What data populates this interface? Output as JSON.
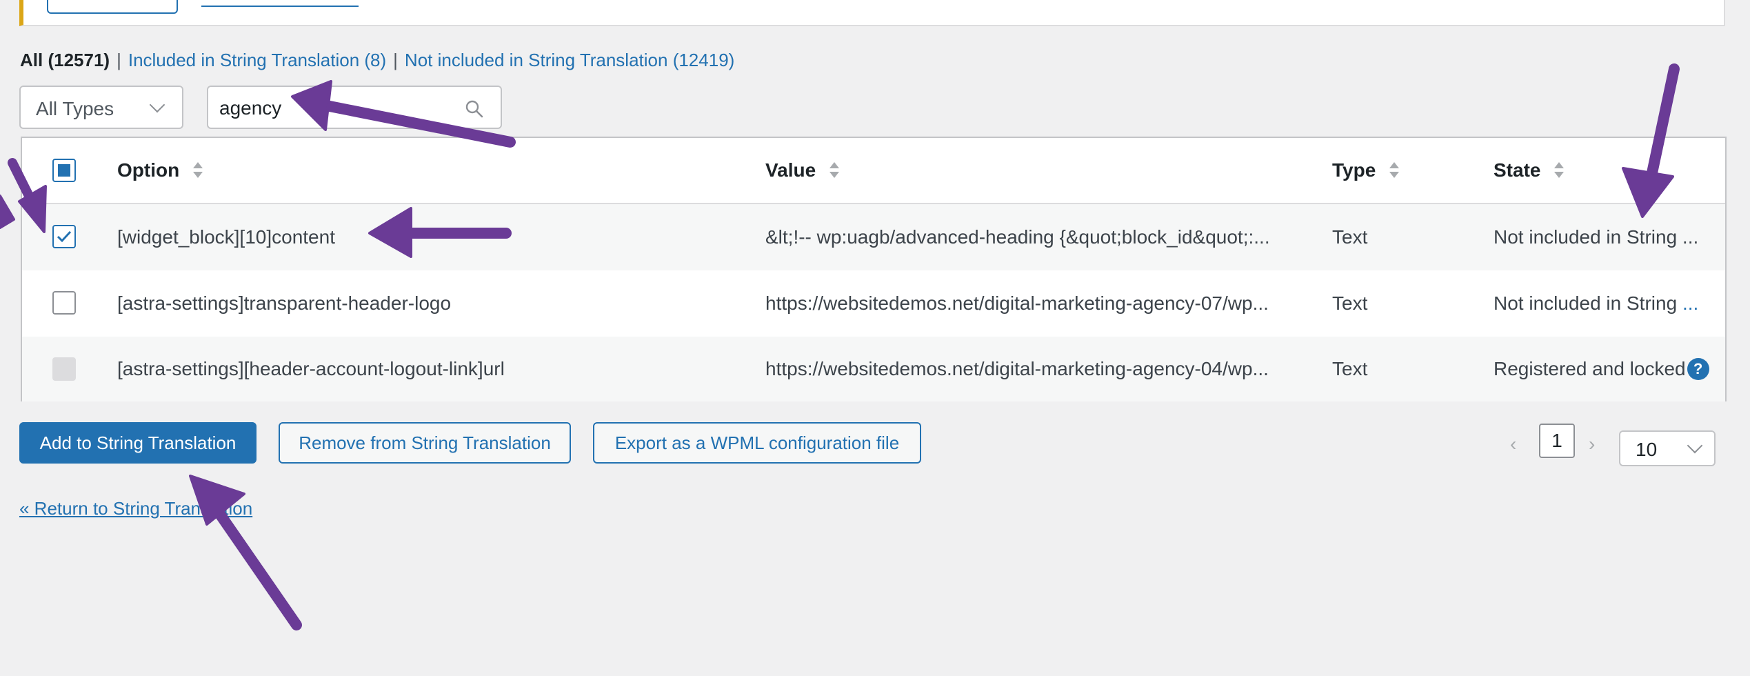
{
  "filters": {
    "all": "All (12571)",
    "separator": "|",
    "included": "Included in String Translation (8)",
    "not_included": "Not included in String Translation (12419)"
  },
  "type_select": {
    "value": "All Types",
    "icon": "chevron-down-icon"
  },
  "search": {
    "value": "agency",
    "icon": "search-icon"
  },
  "table": {
    "columns": [
      "Option",
      "Value",
      "Type",
      "State"
    ],
    "rows": [
      {
        "option": "[widget_block][10]content",
        "value": "&lt;!-- wp:uagb/advanced-heading {&quot;block_id&quot;:...",
        "type": "Text",
        "state": "Not included in String ...",
        "checked": true
      },
      {
        "option": "[astra-settings]transparent-header-logo",
        "value": "https://websitedemos.net/digital-marketing-agency-07/wp...",
        "type": "Text",
        "state": "Not included in String",
        "state_more": "...",
        "checked": false
      },
      {
        "option": "[astra-settings][header-account-logout-link]url",
        "value": "https://websitedemos.net/digital-marketing-agency-04/wp...",
        "type": "Text",
        "state": "Registered and locked",
        "help": "?",
        "disabled": true
      }
    ]
  },
  "actions": {
    "add": "Add to String Translation",
    "remove": "Remove from String Translation",
    "export": "Export as a WPML configuration file"
  },
  "pagination": {
    "prev": "‹",
    "page": "1",
    "next": "›",
    "per_page": "10"
  },
  "return_link": "« Return to String Translation",
  "colors": {
    "accent": "#2271b1",
    "annotation_arrow": "#6a3b96",
    "notice_border": "#dba617"
  }
}
